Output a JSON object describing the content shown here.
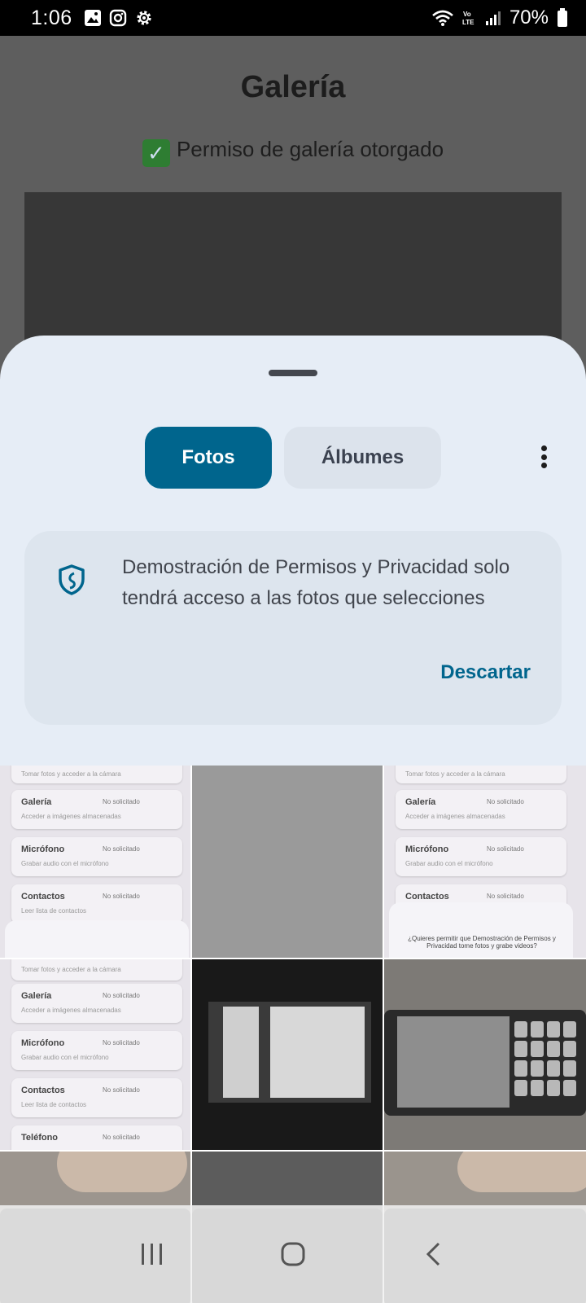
{
  "status_bar": {
    "time": "1:06",
    "battery": "70%",
    "network_label": "Vo LTE"
  },
  "background_app": {
    "title": "Galería",
    "permission_status": "Permiso de galería otorgado"
  },
  "picker": {
    "tabs": [
      {
        "label": "Fotos",
        "selected": true
      },
      {
        "label": "Álbumes",
        "selected": false
      }
    ],
    "info": {
      "message": "Demostración de Permisos y Privacidad solo tendrá acceso a las fotos que selecciones",
      "dismiss_label": "Descartar"
    },
    "accent_color": "#00658d"
  },
  "thumbnails": {
    "screen_rows": [
      {
        "title": "Galería",
        "subtitle": "Acceder a imágenes almacenadas",
        "badge": "No solicitado"
      },
      {
        "title": "Micrófono",
        "subtitle": "Grabar audio con el micrófono",
        "badge": "No solicitado"
      },
      {
        "title": "Contactos",
        "subtitle": "Leer lista de contactos",
        "badge": "No solicitado"
      },
      {
        "title": "Teléfono",
        "subtitle": "",
        "badge": "No solicitado"
      }
    ],
    "top_caption": "Tomar fotos y acceder a la cámara",
    "camera_prompt": "¿Quieres permitir que Demostración de Permisos y Privacidad tome fotos y grabe videos?"
  }
}
